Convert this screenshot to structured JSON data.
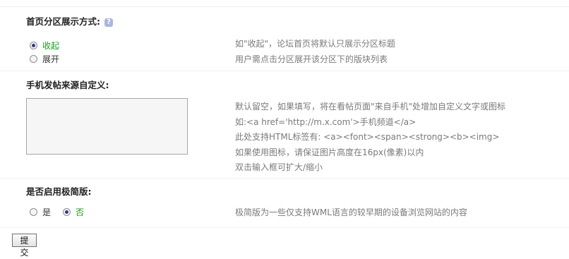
{
  "sections": {
    "display_mode": {
      "title": "首页分区展示方式:",
      "help_icon": "help-icon",
      "options": [
        {
          "label": "收起",
          "selected": true
        },
        {
          "label": "展开",
          "selected": false
        }
      ],
      "desc": [
        "如\"收起\"，论坛首页将默认只展示分区标题",
        "用户需点击分区展开该分区下的版块列表"
      ]
    },
    "mobile_source": {
      "title": "手机发帖来源自定义:",
      "textarea_value": "",
      "desc": [
        "默认留空，如果填写，将在看帖页面\"来自手机\"处增加自定义文字或图标",
        "如:<a href='http://m.x.com'>手机频道</a>",
        "此处支持HTML标签有: <a><font><span><strong><b><img>",
        "如果使用图标，请保证图片高度在16px(像素)以内",
        "双击输入框可扩大/缩小"
      ]
    },
    "minimal_mode": {
      "title": "是否启用极简版:",
      "options": [
        {
          "label": "是",
          "selected": false
        },
        {
          "label": "否",
          "selected": true
        }
      ],
      "desc": "极简版为一些仅支持WML语言的较早期的设备浏览网站的内容"
    }
  },
  "submit_label": "提交",
  "colors": {
    "selected_label": "#1a9d1a",
    "desc_text": "#7a7a7a",
    "separator": "#eef0f3"
  }
}
